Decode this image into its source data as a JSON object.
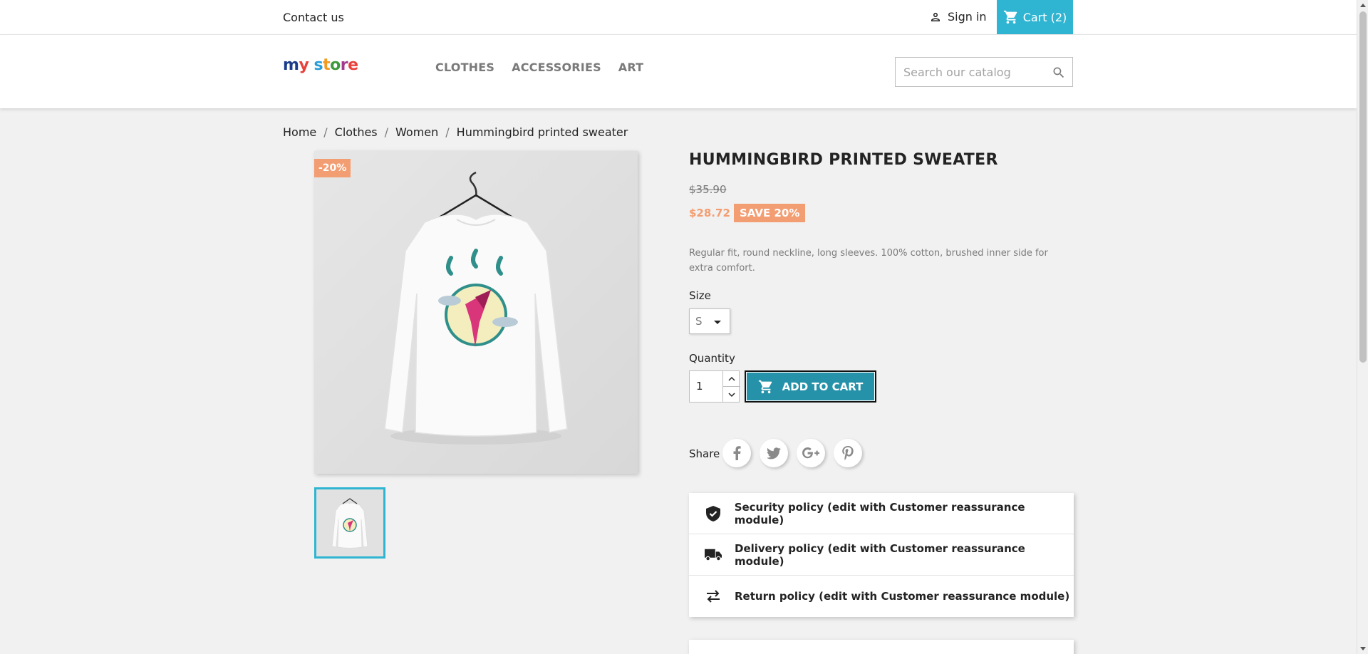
{
  "topnav": {
    "contact": "Contact us",
    "signin": "Sign in",
    "cart": "Cart (2)"
  },
  "header": {
    "logo": [
      "m",
      "y",
      " ",
      "s",
      "t",
      "o",
      "r",
      "e"
    ],
    "menu": [
      "CLOTHES",
      "ACCESSORIES",
      "ART"
    ],
    "search_placeholder": "Search our catalog"
  },
  "breadcrumb": [
    "Home",
    "Clothes",
    "Women",
    "Hummingbird printed sweater"
  ],
  "product": {
    "discount_flag": "-20%",
    "title": "HUMMINGBIRD PRINTED SWEATER",
    "regular_price": "$35.90",
    "price": "$28.72",
    "save_badge": "SAVE 20%",
    "description": "Regular fit, round neckline, long sleeves. 100% cotton, brushed inner side for extra comfort.",
    "size_label": "Size",
    "size_value": "S",
    "quantity_label": "Quantity",
    "quantity_value": "1",
    "add_to_cart": "ADD TO CART",
    "share_label": "Share"
  },
  "reassurance": [
    {
      "icon": "shield-check-icon",
      "text": "Security policy (edit with Customer reassurance module)"
    },
    {
      "icon": "truck-icon",
      "text": "Delivery policy (edit with Customer reassurance module)"
    },
    {
      "icon": "swap-arrows-icon",
      "text": "Return policy (edit with Customer reassurance module)"
    }
  ],
  "colors": {
    "accent": "#2fb5d2",
    "add_to_cart_bg": "#2592a9",
    "discount": "#f39d72"
  }
}
